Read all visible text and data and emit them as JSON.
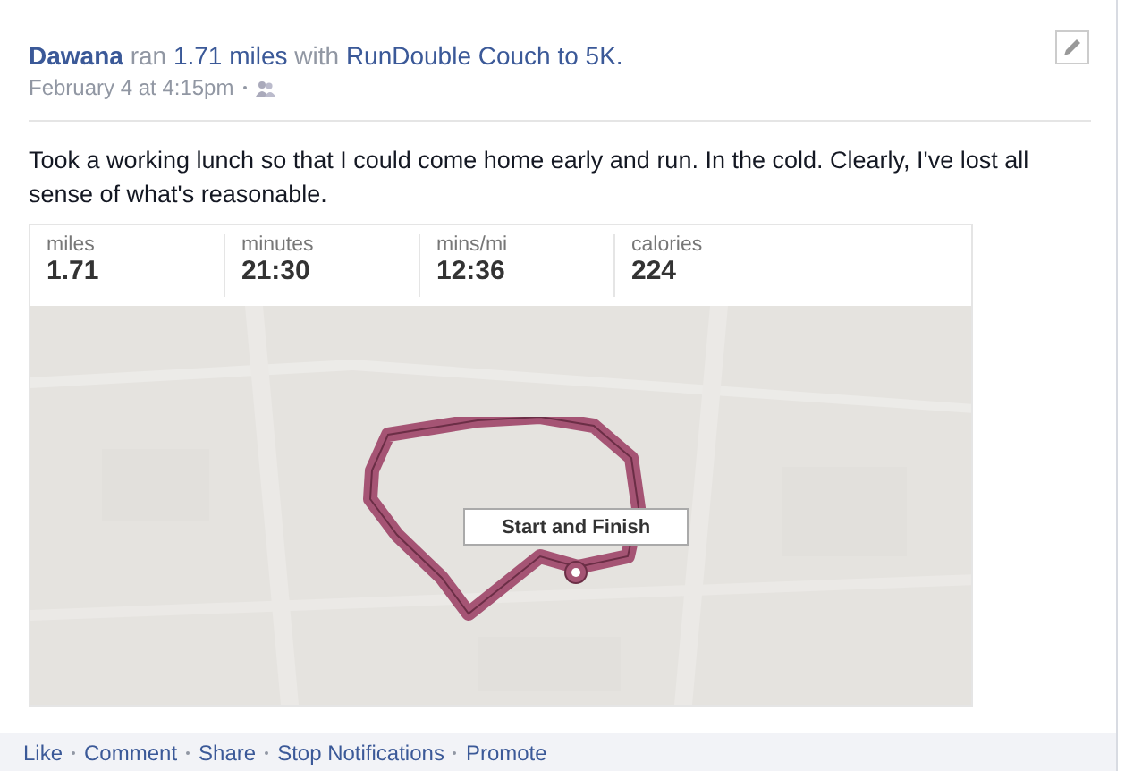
{
  "headline": [
    {
      "text": "Dawana",
      "kind": "name"
    },
    {
      "text": "ran",
      "kind": "plain"
    },
    {
      "text": "1.71 miles",
      "kind": "link"
    },
    {
      "text": "with",
      "kind": "plain"
    },
    {
      "text": "RunDouble Couch to 5K.",
      "kind": "link"
    }
  ],
  "timestamp": "February 4 at 4:15pm",
  "message": "Took a working lunch so that I could come home early and run. In the cold. Clearly, I've lost all sense of what's reasonable.",
  "stats": [
    {
      "label": "miles",
      "value": "1.71"
    },
    {
      "label": "minutes",
      "value": "21:30"
    },
    {
      "label": "mins/mi",
      "value": "12:36"
    },
    {
      "label": "calories",
      "value": "224"
    }
  ],
  "map": {
    "kind": "picture",
    "marker_label": "Start and Finish"
  },
  "actions": [
    "Like",
    "Comment",
    "Share",
    "Stop Notifications",
    "Promote"
  ]
}
